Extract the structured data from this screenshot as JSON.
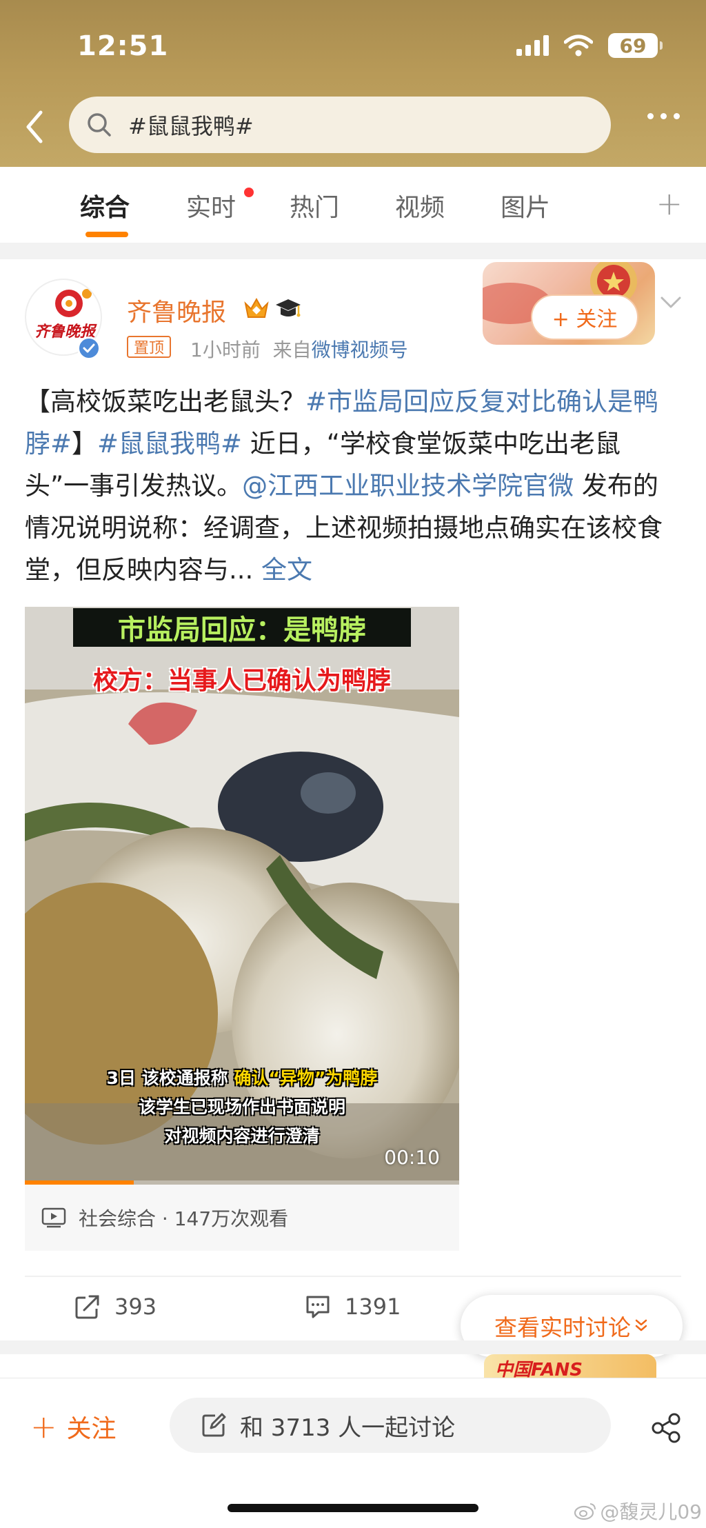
{
  "status_bar": {
    "time": "12:51",
    "battery": "69"
  },
  "search": {
    "query": "#鼠鼠我鸭#"
  },
  "tabs": [
    {
      "label": "综合"
    },
    {
      "label": "实时"
    },
    {
      "label": "热门"
    },
    {
      "label": "视频"
    },
    {
      "label": "图片"
    }
  ],
  "post": {
    "author": "齐鲁晚报",
    "avatar_text": "齐鲁晚报",
    "pin_label": "置顶",
    "time": "1小时前",
    "source_prefix": "来自",
    "source": "微博视频号",
    "follow_label": "+ 关注",
    "text": {
      "part1": "【高校饭菜吃出老鼠头？",
      "topic1": "#市监局回应反复对比确认是鸭脖#",
      "part2": "】",
      "topic2": "#鼠鼠我鸭#",
      "part3": " 近日，“学校食堂饭菜中吃出老鼠头”一事引发热议。",
      "mention": "@江西工业职业技术学院官微",
      "part4": " 发布的情况说明说称：经调查，上述视频拍摄地点确实在该校食堂，但反映内容与...",
      "full_label": " 全文"
    },
    "video": {
      "headline": "市监局回应：是鸭脖",
      "subhead": "校方：当事人已确认为鸭脖",
      "caption1_a": "3日 该校通报称 ",
      "caption1_b": "确认“异物”为鸭脖",
      "caption2": "该学生已现场作出书面说明",
      "caption3": "对视频内容进行澄清",
      "duration": "00:10",
      "progress": 0.25,
      "info": "社会综合 · 147万次观看"
    },
    "actions": {
      "reposts": "393",
      "comments": "1391"
    },
    "live_discussion_label": "查看实时讨论"
  },
  "next_post_banner": "中国FANS",
  "bottom_bar": {
    "follow_label": "关注",
    "discuss_placeholder": "和 3713 人一起讨论"
  },
  "watermark": "@馥灵儿09",
  "colors": {
    "accent": "#ff8200",
    "link": "#4b79b0",
    "author": "#e8752e",
    "header": "#b89a58"
  }
}
